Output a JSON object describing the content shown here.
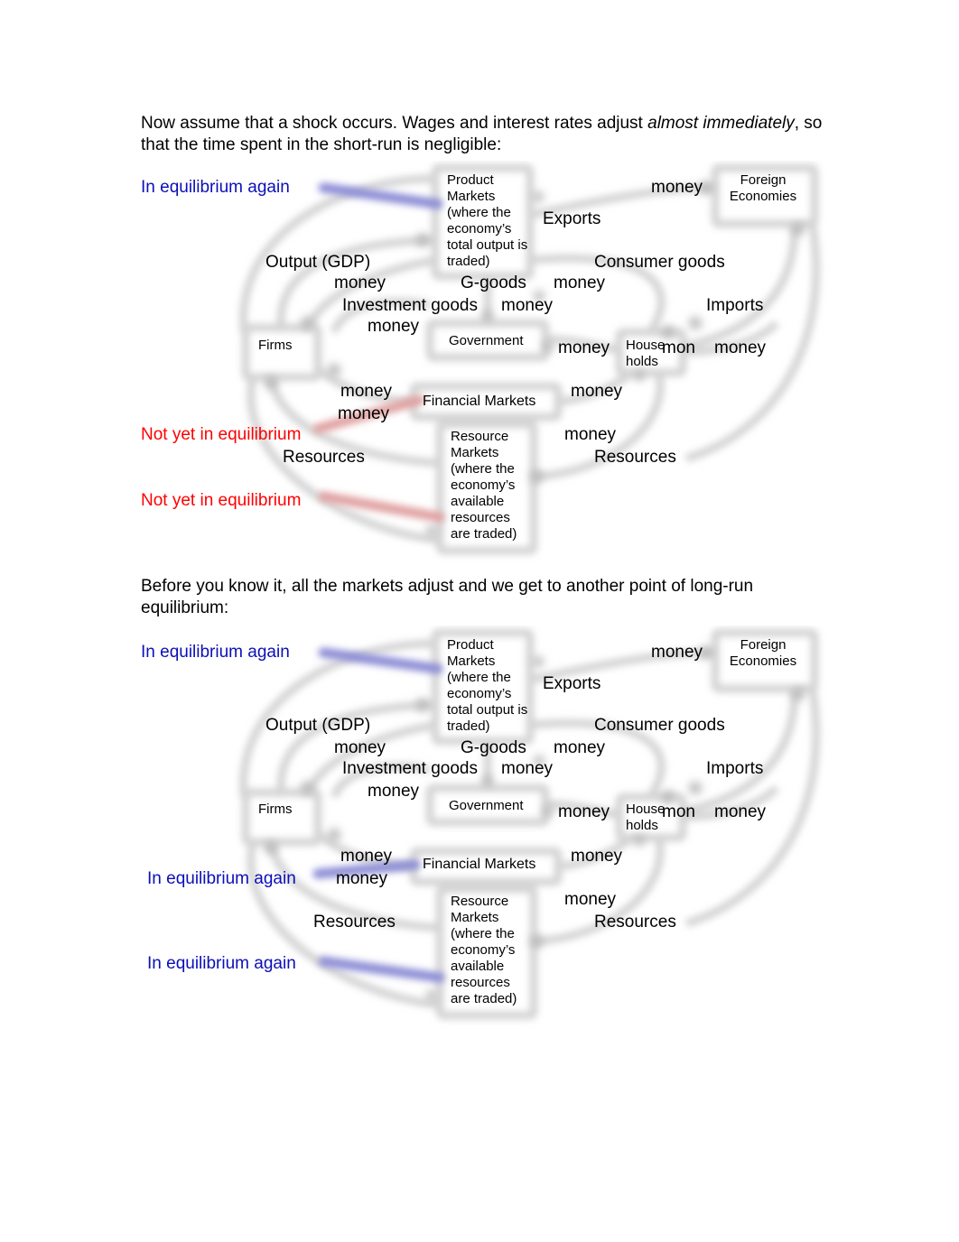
{
  "paragraph1": {
    "before_italic": "Now assume that a shock occurs. Wages and interest rates adjust ",
    "italic": "almost immediately",
    "after_italic": ", so that the time spent in the short-run is negligible:"
  },
  "paragraph2": {
    "text": "Before you know it, all the markets adjust and we get to another point of long-run equilibrium:"
  },
  "colors": {
    "equilibrium": "#0b0fb8",
    "not_equilibrium": "#ff0000",
    "diagram_shapes": "#c8c8c8"
  },
  "diagram_common": {
    "product_markets": "Product Markets (where the economy’s total output is traded)",
    "foreign_economies": "Foreign Economies",
    "firms": "Firms",
    "government": "Government",
    "households_line1": "House",
    "households_line2": "holds",
    "financial_markets": "Financial Markets",
    "resource_markets": "Resource Markets (where the economy’s available resources are traded)",
    "exports": "Exports",
    "imports": "Imports",
    "output_gdp": "Output (GDP)",
    "consumer_goods": "Consumer goods",
    "g_goods": "G-goods",
    "investment_goods": "Investment goods",
    "resources": "Resources",
    "money": "money",
    "mon": "mon"
  },
  "diagram1": {
    "status_product": "In equilibrium again",
    "status_financial": "Not yet in equilibrium",
    "status_resource": "Not yet in equilibrium"
  },
  "diagram2": {
    "status_product": "In equilibrium again",
    "status_financial": "In equilibrium again",
    "status_resource": "In equilibrium again"
  }
}
